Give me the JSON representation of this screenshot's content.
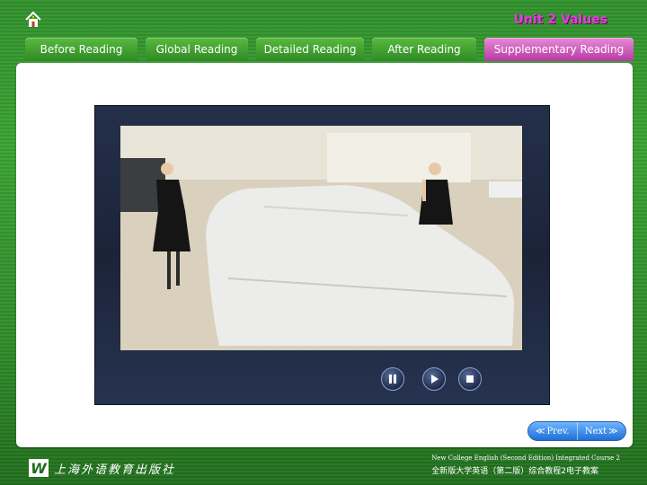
{
  "header": {
    "home_icon": "home-icon",
    "title": "Unit 2  Values",
    "title_color": "#e040d8"
  },
  "tabs": [
    {
      "label": "Before Reading",
      "active": false
    },
    {
      "label": "Global Reading",
      "active": false
    },
    {
      "label": "Detailed Reading",
      "active": false
    },
    {
      "label": "After Reading",
      "active": false
    },
    {
      "label": "Supplementary Reading",
      "active": true
    }
  ],
  "colors": {
    "tab_bg": "#3a9a2e",
    "tab_active_bg": "#cf5fbd",
    "background": "#2f8f2a",
    "player_bg": "#1f2a44",
    "nav_button_bg": "#3b8ff0"
  },
  "video_player": {
    "controls": [
      {
        "name": "pause-button",
        "icon": "pause-icon"
      },
      {
        "name": "play-button",
        "icon": "play-icon"
      },
      {
        "name": "stop-button",
        "icon": "stop-icon"
      }
    ]
  },
  "pager": {
    "prev_label": "Prev.",
    "next_label": "Next",
    "prev_icon": "double-chevron-left-icon",
    "next_icon": "double-chevron-right-icon"
  },
  "footer": {
    "publisher_logo": "W",
    "publisher_name": "上海外语教育出版社",
    "course_en": "New College English (Second Edition) Integrated Course 2",
    "course_cn": "全新版大学英语（第二版）综合教程2电子教案"
  }
}
